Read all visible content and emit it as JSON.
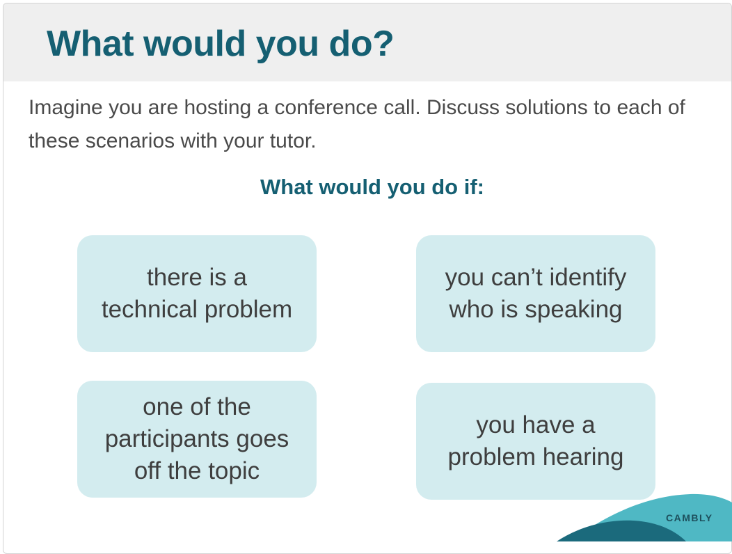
{
  "header": {
    "title": "What would you do?"
  },
  "intro": {
    "text": "Imagine you are hosting a conference call. Discuss solutions to each of these scenarios with your tutor."
  },
  "prompt": {
    "heading": "What would you do if:"
  },
  "scenarios": [
    {
      "text": "there is a\ntechnical problem"
    },
    {
      "text": "you can’t identify\nwho is speaking"
    },
    {
      "text": "one of the\nparticipants goes\noff the topic"
    },
    {
      "text": "you have a\nproblem hearing"
    }
  ],
  "brand": {
    "name": "CAMBLY",
    "colors": {
      "primary": "#155f72",
      "box": "#d3ecef",
      "accent_light": "#4fb8c4",
      "accent_dark": "#1b6a7c"
    }
  }
}
